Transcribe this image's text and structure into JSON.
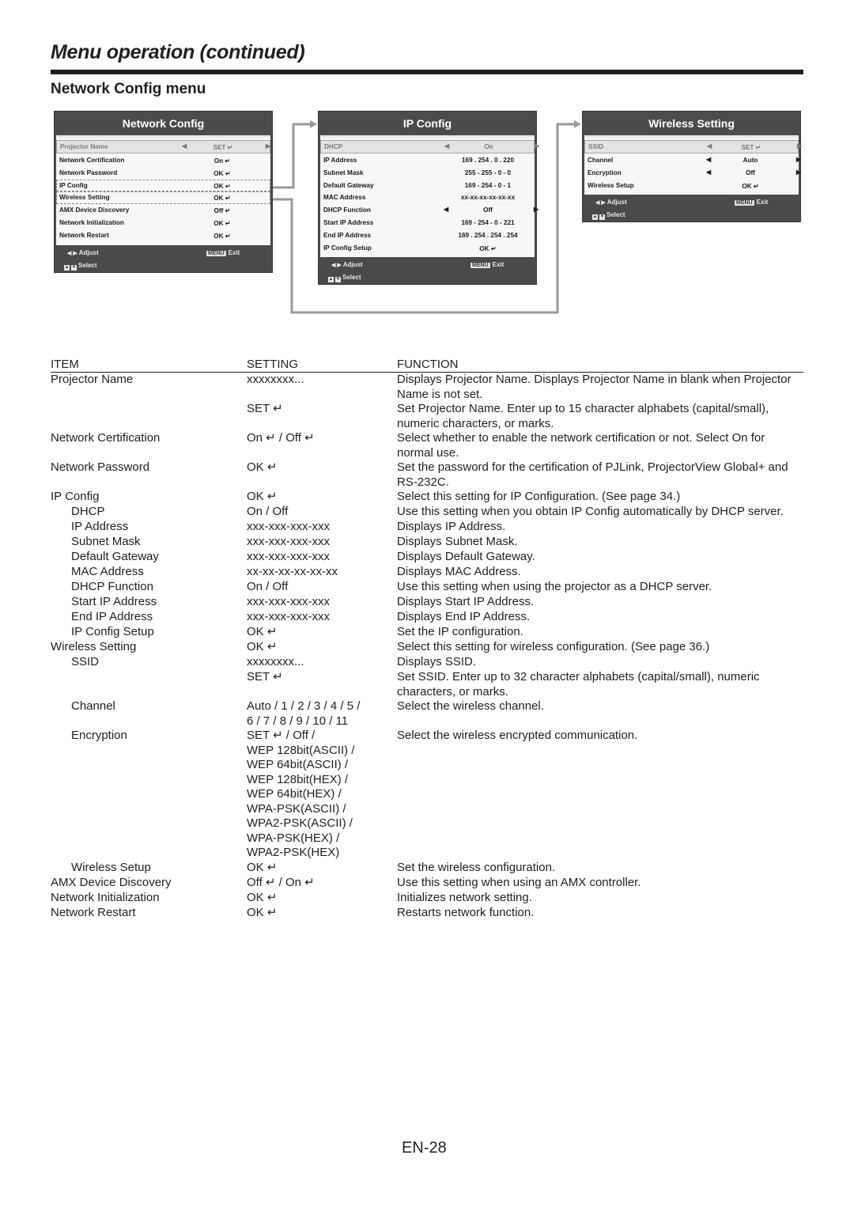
{
  "page": {
    "title": "Menu operation (continued)",
    "section_title": "Network Config menu",
    "page_number": "EN-28"
  },
  "menus": {
    "network_config": {
      "title": "Network Config",
      "rows": [
        {
          "label": "Projector Name",
          "value": "SET ↵",
          "selected": true,
          "arrows": true
        },
        {
          "label": "Network Certification",
          "value": "On ↵"
        },
        {
          "label": "Network Password",
          "value": "OK ↵"
        },
        {
          "label": "IP Config",
          "value": "OK ↵",
          "linked": true
        },
        {
          "label": "Wireless Setting",
          "value": "OK ↵",
          "linked": true
        },
        {
          "label": "AMX Device Discovery",
          "value": "Off ↵"
        },
        {
          "label": "Network Initialization",
          "value": "OK ↵"
        },
        {
          "label": "Network Restart",
          "value": "OK ↵"
        }
      ],
      "footer": {
        "adjust": "Adjust",
        "select": "Select",
        "menu_key": "MENU",
        "exit": "Exit"
      }
    },
    "ip_config": {
      "title": "IP Config",
      "rows": [
        {
          "label": "DHCP",
          "value": "On",
          "selected": true,
          "arrows": true
        },
        {
          "label": "IP Address",
          "value": "169 . 254 .  0  . 220"
        },
        {
          "label": "Subnet Mask",
          "value": "255 - 255 -  0  -  0"
        },
        {
          "label": "Default Gateway",
          "value": "169 - 254 -  0  -  1"
        },
        {
          "label": "MAC Address",
          "value": "xx-xx-xx-xx-xx-xx"
        },
        {
          "label": "DHCP Function",
          "value": "Off",
          "arrows": true
        },
        {
          "label": "Start IP Address",
          "value": "169 - 254 -  0  - 221"
        },
        {
          "label": "End IP Address",
          "value": "169 . 254 . 254 . 254"
        },
        {
          "label": "IP Config Setup",
          "value": "OK ↵"
        }
      ],
      "footer": {
        "adjust": "Adjust",
        "select": "Select",
        "menu_key": "MENU",
        "exit": "Exit"
      }
    },
    "wireless_setting": {
      "title": "Wireless Setting",
      "rows": [
        {
          "label": "SSID",
          "value": "SET ↵",
          "selected": true,
          "arrows": true
        },
        {
          "label": "Channel",
          "value": "Auto",
          "arrows": true
        },
        {
          "label": "Encryption",
          "value": "Off",
          "arrows": true
        },
        {
          "label": "Wireless Setup",
          "value": "OK ↵"
        }
      ],
      "footer": {
        "adjust": "Adjust",
        "select": "Select",
        "menu_key": "MENU",
        "exit": "Exit"
      }
    }
  },
  "table": {
    "headers": {
      "item": "ITEM",
      "setting": "SETTING",
      "function": "FUNCTION"
    },
    "rows": [
      {
        "item": "Projector Name",
        "indent": false,
        "setting": [
          "xxxxxxxx..."
        ],
        "function": "Displays Projector Name. Displays Projector Name in blank when Projector Name is not set."
      },
      {
        "item": "",
        "indent": false,
        "setting": [
          "SET ↵"
        ],
        "function": "Set Projector Name. Enter up to 15 character alphabets (capital/small), numeric characters, or marks."
      },
      {
        "item": "Network Certification",
        "indent": false,
        "setting": [
          "On ↵ / Off ↵"
        ],
        "function": "Select whether to enable the network certification or not. Select On for normal use."
      },
      {
        "item": "Network Password",
        "indent": false,
        "setting": [
          "OK ↵"
        ],
        "function": "Set the password for the certification of PJLink, ProjectorView Global+ and RS-232C."
      },
      {
        "item": "IP Config",
        "indent": false,
        "setting": [
          "OK ↵"
        ],
        "function": "Select this setting for IP Configuration. (See page 34.)"
      },
      {
        "item": "DHCP",
        "indent": true,
        "setting": [
          "On / Off"
        ],
        "function": "Use this setting when you obtain IP Config automatically by DHCP server."
      },
      {
        "item": "IP Address",
        "indent": true,
        "setting": [
          "xxx-xxx-xxx-xxx"
        ],
        "function": "Displays IP Address."
      },
      {
        "item": "Subnet Mask",
        "indent": true,
        "setting": [
          "xxx-xxx-xxx-xxx"
        ],
        "function": "Displays Subnet Mask."
      },
      {
        "item": "Default Gateway",
        "indent": true,
        "setting": [
          "xxx-xxx-xxx-xxx"
        ],
        "function": "Displays Default Gateway."
      },
      {
        "item": "MAC Address",
        "indent": true,
        "setting": [
          "xx-xx-xx-xx-xx-xx"
        ],
        "function": "Displays MAC Address."
      },
      {
        "item": "DHCP Function",
        "indent": true,
        "setting": [
          "On / Off"
        ],
        "function": "Use this setting when using the projector as a DHCP server."
      },
      {
        "item": "Start IP Address",
        "indent": true,
        "setting": [
          "xxx-xxx-xxx-xxx"
        ],
        "function": "Displays Start IP Address."
      },
      {
        "item": "End IP Address",
        "indent": true,
        "setting": [
          "xxx-xxx-xxx-xxx"
        ],
        "function": "Displays End IP Address."
      },
      {
        "item": "IP Config Setup",
        "indent": true,
        "setting": [
          "OK ↵"
        ],
        "function": "Set the IP configuration."
      },
      {
        "item": "Wireless Setting",
        "indent": false,
        "setting": [
          "OK ↵"
        ],
        "function": "Select this setting for wireless configuration. (See page 36.)"
      },
      {
        "item": "SSID",
        "indent": true,
        "setting": [
          "xxxxxxxx..."
        ],
        "function": "Displays SSID."
      },
      {
        "item": "",
        "indent": false,
        "setting": [
          "SET ↵"
        ],
        "function": "Set SSID. Enter up to 32 character alphabets (capital/small), numeric characters, or marks."
      },
      {
        "item": "Channel",
        "indent": true,
        "setting": [
          "Auto / 1 / 2 / 3 / 4 / 5 /",
          "6 / 7 / 8 / 9 / 10 / 11"
        ],
        "function": "Select the wireless channel."
      },
      {
        "item": "Encryption",
        "indent": true,
        "setting": [
          "SET ↵ / Off /",
          "WEP 128bit(ASCII) /",
          "WEP 64bit(ASCII) /",
          "WEP 128bit(HEX) /",
          "WEP 64bit(HEX) /",
          "WPA-PSK(ASCII) /",
          "WPA2-PSK(ASCII) /",
          "WPA-PSK(HEX) /",
          "WPA2-PSK(HEX)"
        ],
        "function": "Select the wireless encrypted communication."
      },
      {
        "item": "Wireless Setup",
        "indent": true,
        "setting": [
          "OK ↵"
        ],
        "function": "Set the wireless configuration."
      },
      {
        "item": "AMX Device Discovery",
        "indent": false,
        "setting": [
          "Off ↵ / On ↵"
        ],
        "function": "Use this setting when using an AMX controller."
      },
      {
        "item": "Network Initialization",
        "indent": false,
        "setting": [
          "OK ↵"
        ],
        "function": "Initializes network setting."
      },
      {
        "item": "Network Restart",
        "indent": false,
        "setting": [
          "OK ↵"
        ],
        "function": "Restarts network function."
      }
    ]
  }
}
